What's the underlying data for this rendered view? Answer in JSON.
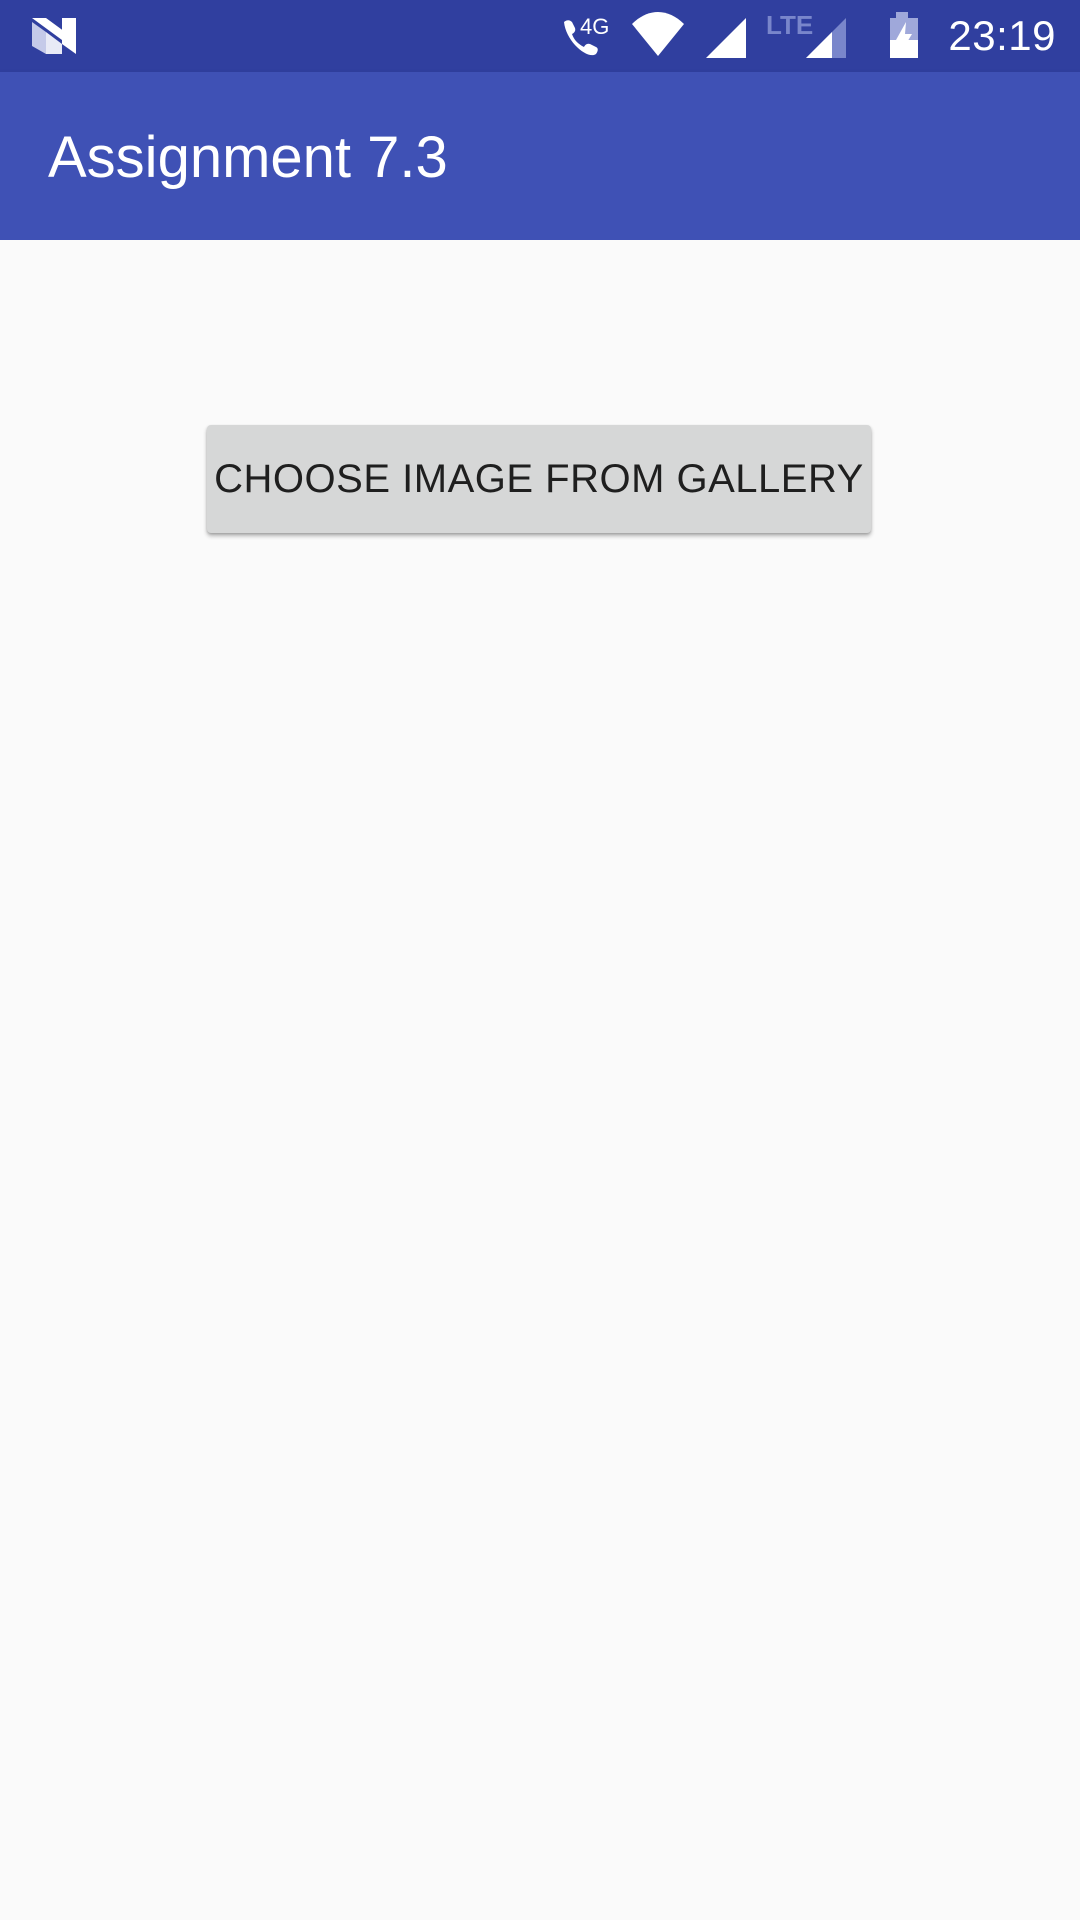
{
  "status_bar": {
    "left_icon": "n-logo-icon",
    "icons": [
      "wifi-calling-4g-icon",
      "wifi-icon",
      "signal-icon",
      "lte-signal-icon",
      "battery-charging-icon"
    ],
    "network_label_4g": "4G",
    "network_label_lte": "LTE",
    "time": "23:19"
  },
  "app_bar": {
    "title": "Assignment 7.3",
    "color": "#3f51b5"
  },
  "main": {
    "choose_button_label": "CHOOSE IMAGE FROM GALLERY"
  },
  "colors": {
    "status_bar": "#303f9f",
    "primary": "#3f51b5",
    "background": "#fafafa",
    "button": "#d6d7d7"
  }
}
